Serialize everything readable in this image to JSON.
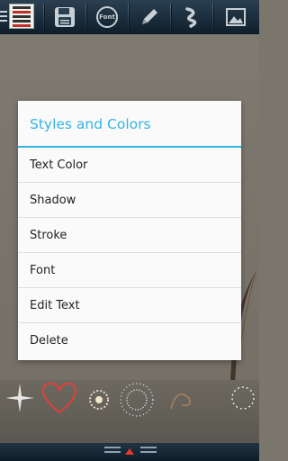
{
  "toolbar": {
    "items": [
      {
        "name": "menu-icon"
      },
      {
        "name": "save-icon"
      },
      {
        "name": "font-icon",
        "label": "Font"
      },
      {
        "name": "pencil-icon"
      },
      {
        "name": "color-icon"
      },
      {
        "name": "image-icon"
      }
    ]
  },
  "dialog": {
    "title": "Styles and Colors",
    "items": [
      {
        "label": "Text Color"
      },
      {
        "label": "Shadow"
      },
      {
        "label": "Stroke"
      },
      {
        "label": "Font"
      },
      {
        "label": "Edit Text"
      },
      {
        "label": "Delete"
      }
    ]
  },
  "effects": {
    "items": [
      "sparkle",
      "heart",
      "burst",
      "fireworks",
      "swirl",
      "spark"
    ]
  },
  "colors": {
    "accent": "#33b5e5",
    "toolbar": "#17293a",
    "canvas": "#7a766c"
  }
}
